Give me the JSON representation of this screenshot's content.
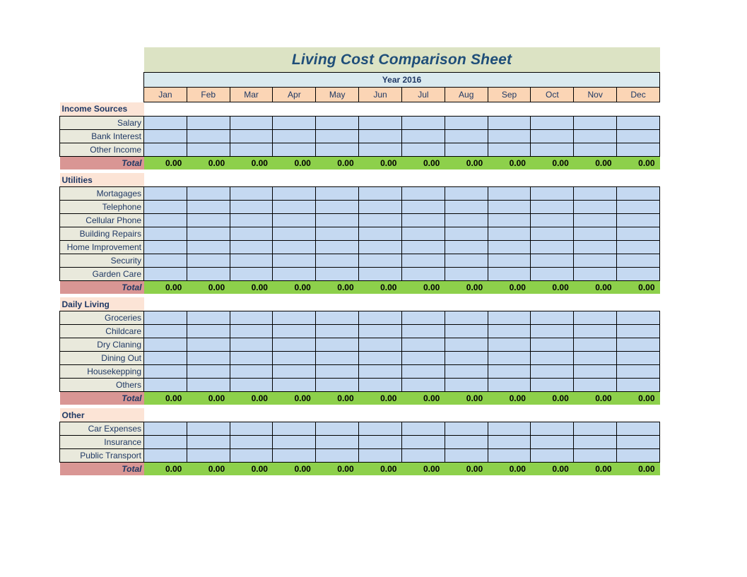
{
  "header": {
    "title": "Living Cost Comparison Sheet",
    "year_label": "Year 2016"
  },
  "columns": {
    "label_header": "",
    "months": [
      "Jan",
      "Feb",
      "Mar",
      "Apr",
      "May",
      "Jun",
      "Jul",
      "Aug",
      "Sep",
      "Oct",
      "Nov",
      "Dec"
    ]
  },
  "colors": {
    "title_band": "#DCE3C4",
    "year_band": "#DAEAEF",
    "month_header": "#FBD5B5",
    "section_header": "#FCE4D6",
    "item_label": "#E9E9DC",
    "item_cell": "#C5D9F1",
    "total_label": "#D99694",
    "total_cell": "#8DD04B",
    "text_navy": "#1F3864",
    "title_text": "#1F4E79",
    "border": "#000000"
  },
  "total_row_label": "Total",
  "sections": [
    {
      "name": "Income Sources",
      "items": [
        {
          "label": "Salary",
          "values": [
            "",
            "",
            "",
            "",
            "",
            "",
            "",
            "",
            "",
            "",
            "",
            ""
          ]
        },
        {
          "label": "Bank Interest",
          "values": [
            "",
            "",
            "",
            "",
            "",
            "",
            "",
            "",
            "",
            "",
            "",
            ""
          ]
        },
        {
          "label": "Other Income",
          "values": [
            "",
            "",
            "",
            "",
            "",
            "",
            "",
            "",
            "",
            "",
            "",
            ""
          ]
        }
      ],
      "totals": [
        "0.00",
        "0.00",
        "0.00",
        "0.00",
        "0.00",
        "0.00",
        "0.00",
        "0.00",
        "0.00",
        "0.00",
        "0.00",
        "0.00"
      ]
    },
    {
      "name": "Utilities",
      "items": [
        {
          "label": "Mortagages",
          "values": [
            "",
            "",
            "",
            "",
            "",
            "",
            "",
            "",
            "",
            "",
            "",
            ""
          ]
        },
        {
          "label": "Telephone",
          "values": [
            "",
            "",
            "",
            "",
            "",
            "",
            "",
            "",
            "",
            "",
            "",
            ""
          ]
        },
        {
          "label": "Cellular Phone",
          "values": [
            "",
            "",
            "",
            "",
            "",
            "",
            "",
            "",
            "",
            "",
            "",
            ""
          ]
        },
        {
          "label": "Building Repairs",
          "values": [
            "",
            "",
            "",
            "",
            "",
            "",
            "",
            "",
            "",
            "",
            "",
            ""
          ]
        },
        {
          "label": "Home Improvement",
          "values": [
            "",
            "",
            "",
            "",
            "",
            "",
            "",
            "",
            "",
            "",
            "",
            ""
          ]
        },
        {
          "label": "Security",
          "values": [
            "",
            "",
            "",
            "",
            "",
            "",
            "",
            "",
            "",
            "",
            "",
            ""
          ]
        },
        {
          "label": "Garden Care",
          "values": [
            "",
            "",
            "",
            "",
            "",
            "",
            "",
            "",
            "",
            "",
            "",
            ""
          ]
        }
      ],
      "totals": [
        "0.00",
        "0.00",
        "0.00",
        "0.00",
        "0.00",
        "0.00",
        "0.00",
        "0.00",
        "0.00",
        "0.00",
        "0.00",
        "0.00"
      ]
    },
    {
      "name": "Daily Living",
      "items": [
        {
          "label": "Groceries",
          "values": [
            "",
            "",
            "",
            "",
            "",
            "",
            "",
            "",
            "",
            "",
            "",
            ""
          ]
        },
        {
          "label": "Childcare",
          "values": [
            "",
            "",
            "",
            "",
            "",
            "",
            "",
            "",
            "",
            "",
            "",
            ""
          ]
        },
        {
          "label": "Dry Claning",
          "values": [
            "",
            "",
            "",
            "",
            "",
            "",
            "",
            "",
            "",
            "",
            "",
            ""
          ]
        },
        {
          "label": "Dining Out",
          "values": [
            "",
            "",
            "",
            "",
            "",
            "",
            "",
            "",
            "",
            "",
            "",
            ""
          ]
        },
        {
          "label": "Housekepping",
          "values": [
            "",
            "",
            "",
            "",
            "",
            "",
            "",
            "",
            "",
            "",
            "",
            ""
          ]
        },
        {
          "label": "Others",
          "values": [
            "",
            "",
            "",
            "",
            "",
            "",
            "",
            "",
            "",
            "",
            "",
            ""
          ]
        }
      ],
      "totals": [
        "0.00",
        "0.00",
        "0.00",
        "0.00",
        "0.00",
        "0.00",
        "0.00",
        "0.00",
        "0.00",
        "0.00",
        "0.00",
        "0.00"
      ]
    },
    {
      "name": "Other",
      "items": [
        {
          "label": "Car Expenses",
          "values": [
            "",
            "",
            "",
            "",
            "",
            "",
            "",
            "",
            "",
            "",
            "",
            ""
          ]
        },
        {
          "label": "Insurance",
          "values": [
            "",
            "",
            "",
            "",
            "",
            "",
            "",
            "",
            "",
            "",
            "",
            ""
          ]
        },
        {
          "label": "Public Transport",
          "values": [
            "",
            "",
            "",
            "",
            "",
            "",
            "",
            "",
            "",
            "",
            "",
            ""
          ]
        }
      ],
      "totals": [
        "0.00",
        "0.00",
        "0.00",
        "0.00",
        "0.00",
        "0.00",
        "0.00",
        "0.00",
        "0.00",
        "0.00",
        "0.00",
        "0.00"
      ]
    }
  ]
}
